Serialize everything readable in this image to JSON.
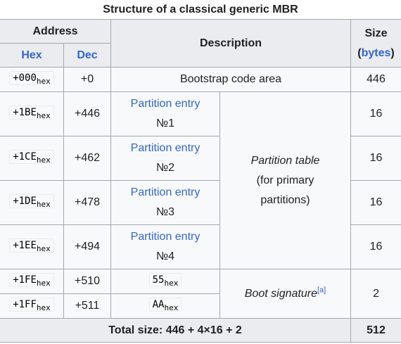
{
  "caption": "Structure of a classical generic MBR",
  "headers": {
    "address": "Address",
    "hex": "Hex",
    "dec": "Dec",
    "description": "Description",
    "size": "Size",
    "size_unit_open": "(",
    "size_unit": "bytes",
    "size_unit_close": ")"
  },
  "hex_suffix": "hex",
  "rows": [
    {
      "hex": "+000",
      "dec": "+0",
      "description": "Bootstrap code area",
      "size": "446"
    },
    {
      "hex": "+1BE",
      "dec": "+446",
      "entry_label": "Partition entry",
      "entry_num": "№1",
      "size": "16"
    },
    {
      "hex": "+1CE",
      "dec": "+462",
      "entry_label": "Partition entry",
      "entry_num": "№2",
      "size": "16"
    },
    {
      "hex": "+1DE",
      "dec": "+478",
      "entry_label": "Partition entry",
      "entry_num": "№3",
      "size": "16"
    },
    {
      "hex": "+1EE",
      "dec": "+494",
      "entry_label": "Partition entry",
      "entry_num": "№4",
      "size": "16"
    },
    {
      "hex": "+1FE",
      "dec": "+510",
      "value": "55"
    },
    {
      "hex": "+1FF",
      "dec": "+511",
      "value": "AA"
    }
  ],
  "partition_table": {
    "line1": "Partition table",
    "line2": "(for primary",
    "line3": "partitions)"
  },
  "boot_signature": {
    "label": "Boot signature",
    "ref": "[a]",
    "size": "2"
  },
  "total": {
    "label": "Total size: 446 + 4×16 + 2",
    "value": "512"
  }
}
